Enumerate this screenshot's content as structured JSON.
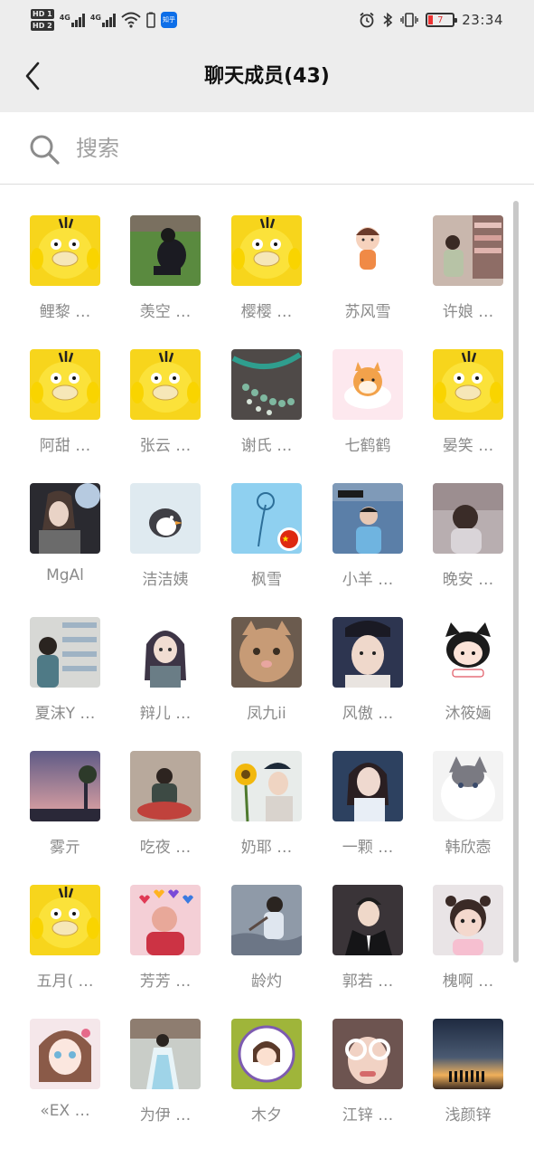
{
  "status_bar": {
    "sim1": "HD 1",
    "sim2": "HD 2",
    "net1": "4G",
    "net2": "4G",
    "app_icon_label": "知乎",
    "battery_level": "7",
    "time": "23:34"
  },
  "header": {
    "title": "聊天成员(43)"
  },
  "search": {
    "placeholder": "搜索"
  },
  "members": [
    {
      "name": "鲤黎 …",
      "avatar": "yellow-duck"
    },
    {
      "name": "羡空 …",
      "avatar": "man-on-grass"
    },
    {
      "name": "樱樱 …",
      "avatar": "yellow-duck"
    },
    {
      "name": "苏风雪",
      "avatar": "cartoon-boy"
    },
    {
      "name": "许娘 …",
      "avatar": "girl-at-shop"
    },
    {
      "name": "阿甜 …",
      "avatar": "yellow-duck"
    },
    {
      "name": "张云 …",
      "avatar": "yellow-duck"
    },
    {
      "name": "谢氏 …",
      "avatar": "bead-bracelet"
    },
    {
      "name": "七鹤鹤",
      "avatar": "shiba-dog"
    },
    {
      "name": "晏笑 …",
      "avatar": "yellow-duck"
    },
    {
      "name": "MgAl",
      "avatar": "girl-light"
    },
    {
      "name": "洁洁姨",
      "avatar": "penguin"
    },
    {
      "name": "枫雪",
      "avatar": "blue-flower-flag"
    },
    {
      "name": "小羊 …",
      "avatar": "boy-city"
    },
    {
      "name": "晚安 …",
      "avatar": "girl-back"
    },
    {
      "name": "夏沫Y …",
      "avatar": "girl-store"
    },
    {
      "name": "辩儿 …",
      "avatar": "anime-girl"
    },
    {
      "name": "凤九ii",
      "avatar": "kitten"
    },
    {
      "name": "风傲 …",
      "avatar": "costume-man"
    },
    {
      "name": "沐筱婳",
      "avatar": "chibi-girl"
    },
    {
      "name": "雾亓",
      "avatar": "sunset-street"
    },
    {
      "name": "吃夜 …",
      "avatar": "girl-sitting"
    },
    {
      "name": "奶耶 …",
      "avatar": "sunflower-girl"
    },
    {
      "name": "一颗 …",
      "avatar": "woman-portrait"
    },
    {
      "name": "韩欣悫",
      "avatar": "cat-white"
    },
    {
      "name": "五月( …",
      "avatar": "yellow-duck"
    },
    {
      "name": "芳芳 …",
      "avatar": "hearts-man"
    },
    {
      "name": "龄灼",
      "avatar": "girl-water"
    },
    {
      "name": "郭若 …",
      "avatar": "man-suit"
    },
    {
      "name": "槐啊 …",
      "avatar": "toddler"
    },
    {
      "name": "«EX …",
      "avatar": "doll-girl"
    },
    {
      "name": "为伊 …",
      "avatar": "hanfu-girl"
    },
    {
      "name": "木夕",
      "avatar": "cartoon-circle"
    },
    {
      "name": "江锌 …",
      "avatar": "glasses-kid"
    },
    {
      "name": "浅颜锌",
      "avatar": "sunset-silhouettes"
    }
  ],
  "colors": {
    "header_bg": "#ededed",
    "name_text": "#8a8a8a",
    "duck_yellow": "#f7d51c"
  }
}
